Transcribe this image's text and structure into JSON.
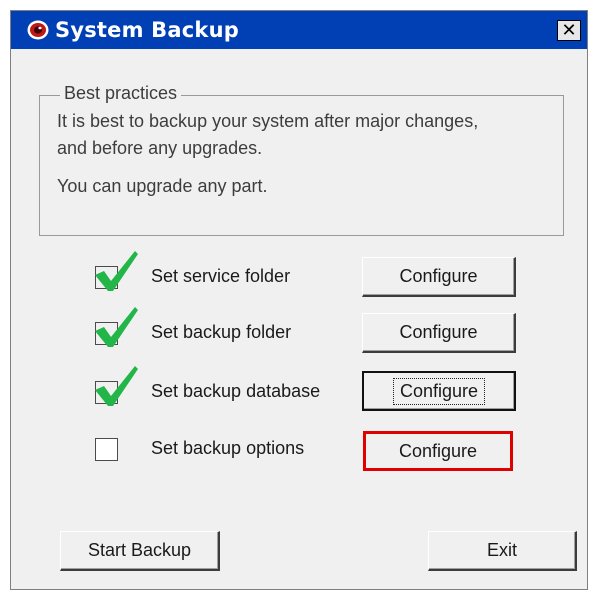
{
  "window": {
    "title": "System Backup",
    "close_label": "✕",
    "app_icon": "eye-icon"
  },
  "best_practices": {
    "legend": "Best practices",
    "line1": "It is best to backup your system after major changes,",
    "line2": "and before any upgrades.",
    "line3": "You can upgrade any part."
  },
  "steps": [
    {
      "label": "Set service folder",
      "checked": true,
      "button": "Configure"
    },
    {
      "label": "Set backup folder",
      "checked": true,
      "button": "Configure"
    },
    {
      "label": "Set backup database",
      "checked": true,
      "button": "Configure",
      "state": "focused"
    },
    {
      "label": "Set backup options",
      "checked": false,
      "button": "Configure",
      "state": "highlighted"
    }
  ],
  "footer": {
    "start_label": "Start Backup",
    "exit_label": "Exit"
  },
  "colors": {
    "titlebar": "#003fb4",
    "highlight": "#e00000",
    "checkmark": "#22b548"
  }
}
